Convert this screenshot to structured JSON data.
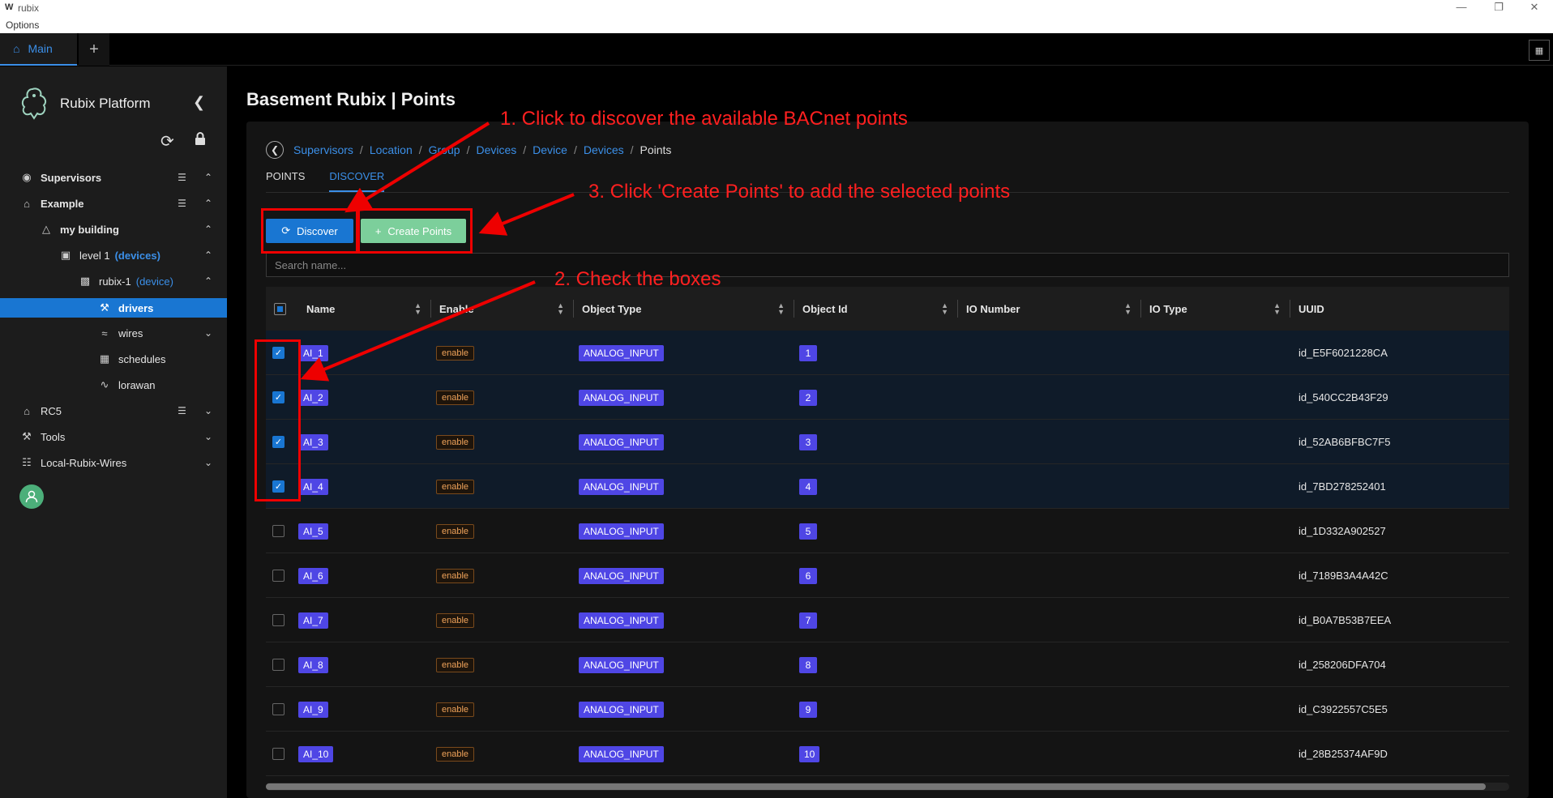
{
  "window": {
    "logo": "W",
    "title": "rubix",
    "menu": "Options"
  },
  "tabbar": {
    "main_tab": "Main",
    "add_tab": "+"
  },
  "sidebar": {
    "brand": "Rubix Platform",
    "items": [
      {
        "label": "Supervisors",
        "icon": "eye-icon",
        "bold": true
      },
      {
        "label": "Example",
        "icon": "home-icon",
        "bold": true
      },
      {
        "label": "my building",
        "icon": "building-icon",
        "bold": true
      },
      {
        "label": "level 1",
        "tag": "(devices)",
        "icon": "monitor-icon"
      },
      {
        "label": "rubix-1",
        "tag": "(device)",
        "icon": "device-icon"
      },
      {
        "label": "drivers",
        "icon": "wrench-icon",
        "active": true
      },
      {
        "label": "wires",
        "icon": "wires-icon"
      },
      {
        "label": "schedules",
        "icon": "calendar-icon"
      },
      {
        "label": "lorawan",
        "icon": "wifi-icon"
      },
      {
        "label": "RC5",
        "icon": "home-icon"
      },
      {
        "label": "Tools",
        "icon": "wrench-icon"
      },
      {
        "label": "Local-Rubix-Wires",
        "icon": "network-icon"
      }
    ]
  },
  "main": {
    "title": "Basement Rubix | Points",
    "breadcrumb": [
      "Supervisors",
      "Location",
      "Group",
      "Devices",
      "Device",
      "Devices"
    ],
    "breadcrumb_current": "Points",
    "tabs": [
      "POINTS",
      "DISCOVER"
    ],
    "active_tab": "DISCOVER",
    "discover_label": "Discover",
    "create_label": "Create Points",
    "search_placeholder": "Search name...",
    "columns": [
      "Name",
      "Enable",
      "Object Type",
      "Object Id",
      "IO Number",
      "IO Type",
      "UUID"
    ],
    "rows": [
      {
        "checked": true,
        "name": "AI_1",
        "enable": "enable",
        "type": "ANALOG_INPUT",
        "id": "1",
        "uuid": "id_E5F6021228CA"
      },
      {
        "checked": true,
        "name": "AI_2",
        "enable": "enable",
        "type": "ANALOG_INPUT",
        "id": "2",
        "uuid": "id_540CC2B43F29"
      },
      {
        "checked": true,
        "name": "AI_3",
        "enable": "enable",
        "type": "ANALOG_INPUT",
        "id": "3",
        "uuid": "id_52AB6BFBC7F5"
      },
      {
        "checked": true,
        "name": "AI_4",
        "enable": "enable",
        "type": "ANALOG_INPUT",
        "id": "4",
        "uuid": "id_7BD278252401"
      },
      {
        "checked": false,
        "name": "AI_5",
        "enable": "enable",
        "type": "ANALOG_INPUT",
        "id": "5",
        "uuid": "id_1D332A902527"
      },
      {
        "checked": false,
        "name": "AI_6",
        "enable": "enable",
        "type": "ANALOG_INPUT",
        "id": "6",
        "uuid": "id_7189B3A4A42C"
      },
      {
        "checked": false,
        "name": "AI_7",
        "enable": "enable",
        "type": "ANALOG_INPUT",
        "id": "7",
        "uuid": "id_B0A7B53B7EEA"
      },
      {
        "checked": false,
        "name": "AI_8",
        "enable": "enable",
        "type": "ANALOG_INPUT",
        "id": "8",
        "uuid": "id_258206DFA704"
      },
      {
        "checked": false,
        "name": "AI_9",
        "enable": "enable",
        "type": "ANALOG_INPUT",
        "id": "9",
        "uuid": "id_C3922557C5E5"
      },
      {
        "checked": false,
        "name": "AI_10",
        "enable": "enable",
        "type": "ANALOG_INPUT",
        "id": "10",
        "uuid": "id_28B25374AF9D"
      }
    ]
  },
  "annotations": {
    "step1": "1. Click to discover the available BACnet points",
    "step2": "2. Check the boxes",
    "step3": "3. Click 'Create Points' to add the selected points"
  },
  "colors": {
    "accent": "#1976d2",
    "create": "#7ccf9b",
    "tag": "#4f46e5",
    "annotation": "#ff2020"
  }
}
